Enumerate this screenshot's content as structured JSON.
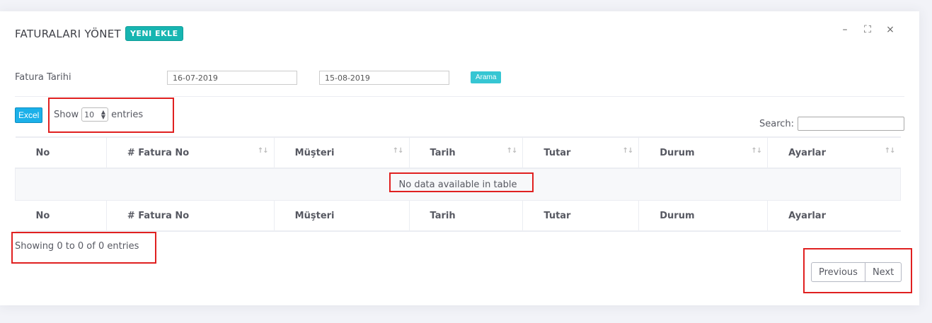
{
  "header": {
    "title": "FATURALARI YÖNET",
    "new_button": "YENI EKLE",
    "minimize_icon": "–",
    "fullscreen_icon": "⛶",
    "close_icon": "×"
  },
  "filter": {
    "label": "Fatura Tarihi",
    "start_date": "16-07-2019",
    "end_date": "15-08-2019",
    "search_button": "Arama"
  },
  "toolbar": {
    "excel_button": "Excel",
    "show_label": "Show",
    "page_length": "10",
    "entries_label": "entries",
    "search_label": "Search:"
  },
  "table": {
    "columns": [
      "No",
      "# Fatura No",
      "Müşteri",
      "Tarih",
      "Tutar",
      "Durum",
      "Ayarlar"
    ],
    "sort_icon": "↑↓",
    "empty_message": "No data available in table"
  },
  "footer": {
    "info": "Showing 0 to 0 of 0 entries",
    "previous": "Previous",
    "next": "Next"
  },
  "colors": {
    "accent_teal": "#17b5b1",
    "search_button": "#36c6d3",
    "excel_button": "#1bb0e9",
    "highlight_box": "#e02020"
  }
}
